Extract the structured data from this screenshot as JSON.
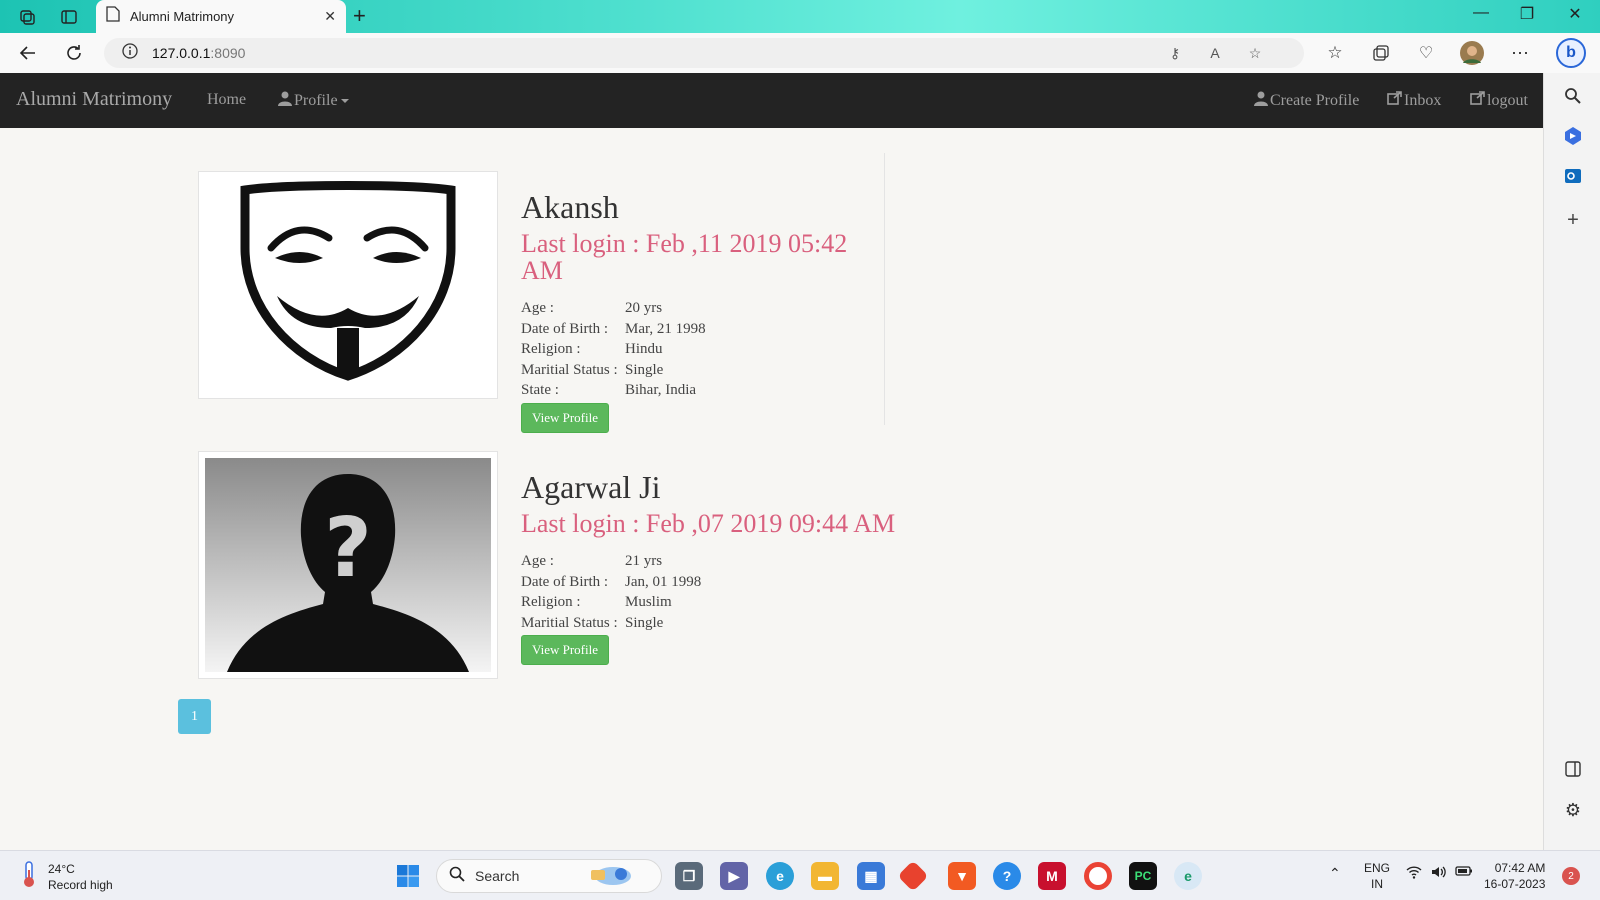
{
  "browser": {
    "tab_title": "Alumni Matrimony",
    "url_host": "127.0.0.1",
    "url_port": ":8090"
  },
  "site": {
    "brand": "Alumni Matrimony",
    "nav_left": {
      "home": "Home",
      "profile": "Profile"
    },
    "nav_right": {
      "create_profile": "Create Profile",
      "inbox": "Inbox",
      "logout": "logout"
    }
  },
  "profiles": [
    {
      "name": "Akansh",
      "last_login": "Last login : Feb ,11 2019 05:42 AM",
      "image_icon": "guy-fawkes-mask-icon",
      "details": [
        {
          "label": "Age :",
          "value": "20 yrs"
        },
        {
          "label": "Date of Birth :",
          "value": "Mar, 21 1998"
        },
        {
          "label": "Religion :",
          "value": "Hindu"
        },
        {
          "label": "Maritial Status :",
          "value": "Single"
        },
        {
          "label": "State :",
          "value": "Bihar, India"
        }
      ],
      "button": "View Profile"
    },
    {
      "name": "Agarwal Ji",
      "last_login": "Last login : Feb ,07 2019 09:44 AM",
      "image_icon": "unknown-person-silhouette-icon",
      "details": [
        {
          "label": "Age :",
          "value": "21 yrs"
        },
        {
          "label": "Date of Birth :",
          "value": "Jan, 01 1998"
        },
        {
          "label": "Religion :",
          "value": "Muslim"
        },
        {
          "label": "Maritial Status :",
          "value": "Single"
        }
      ],
      "button": "View Profile"
    }
  ],
  "pagination": {
    "current": "1"
  },
  "taskbar": {
    "weather_temp": "24°C",
    "weather_desc": "Record high",
    "search": "Search",
    "lang_top": "ENG",
    "lang_bottom": "IN",
    "time": "07:42 AM",
    "date": "16-07-2023",
    "notifications": "2"
  },
  "colors": {
    "navbar": "#232323",
    "last_login": "#d9607e",
    "view_button": "#5cb85c",
    "pager": "#5bc0de"
  }
}
